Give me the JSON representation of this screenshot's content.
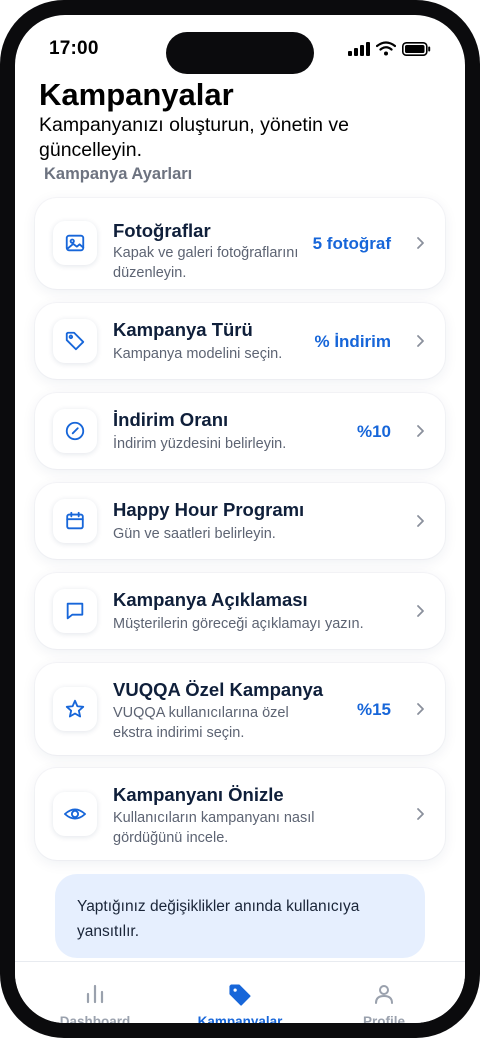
{
  "status_bar": {
    "time": "17:00"
  },
  "header": {
    "title": "Kampanyalar",
    "subtitle": "Kampanyanızı oluşturun, yönetin ve güncelleyin.",
    "section_label": "Kampanya Ayarları"
  },
  "items": [
    {
      "title": "Fotoğraflar",
      "description": "Kapak ve galeri fotoğraflarını düzenleyin.",
      "value": "5 fotoğraf",
      "icon": "image-icon"
    },
    {
      "title": "Kampanya Türü",
      "description": "Kampanya modelini seçin.",
      "value": "% İndirim",
      "icon": "tag-icon"
    },
    {
      "title": "İndirim Oranı",
      "description": "İndirim yüzdesini belirleyin.",
      "value": "%10",
      "icon": "compass-icon"
    },
    {
      "title": "Happy Hour Programı",
      "description": "Gün ve saatleri belirleyin.",
      "value": "",
      "icon": "calendar-icon"
    },
    {
      "title": "Kampanya Açıklaması",
      "description": "Müşterilerin göreceği açıklamayı yazın.",
      "value": "",
      "icon": "message-icon"
    },
    {
      "title": "VUQQA Özel Kampanya",
      "description": "VUQQA kullanıcılarına özel ekstra indirimi seçin.",
      "value": "%15",
      "icon": "star-icon"
    },
    {
      "title": "Kampanyanı Önizle",
      "description": "Kullanıcıların kampanyanı nasıl gördüğünü incele.",
      "value": "",
      "icon": "eye-icon"
    }
  ],
  "info_box": {
    "text": "Yaptığınız değişiklikler anında kullanıcıya yansıtılır."
  },
  "tabbar": {
    "tabs": [
      {
        "label": "Dashboard",
        "icon": "bar-chart-icon",
        "active": false
      },
      {
        "label": "Kampanyalar",
        "icon": "tag-icon",
        "active": true
      },
      {
        "label": "Profile",
        "icon": "user-icon",
        "active": false
      }
    ]
  },
  "colors": {
    "accent": "#1766d9",
    "inactive": "#9aa1ad",
    "info_bg": "#e6effe"
  }
}
